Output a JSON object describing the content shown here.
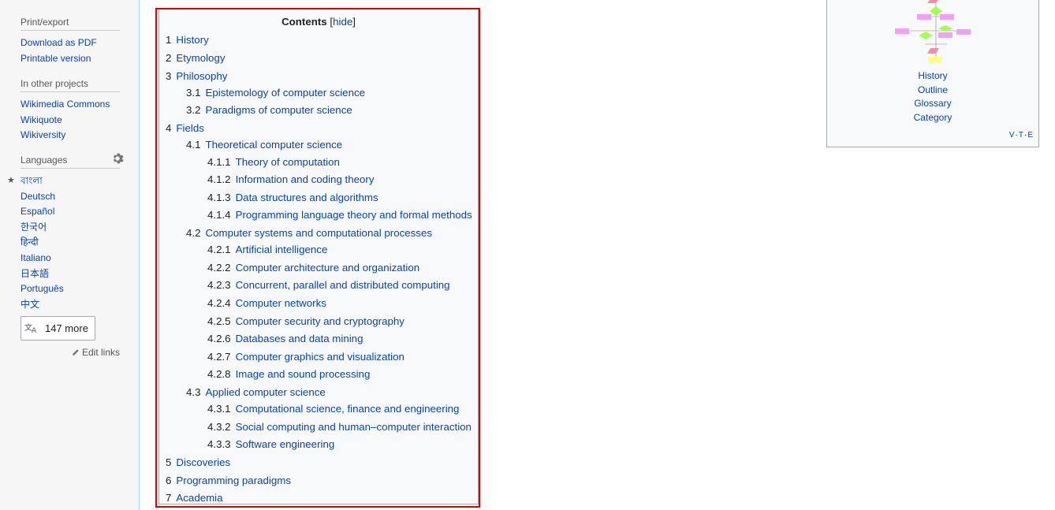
{
  "sidebar": {
    "print_export": {
      "heading": "Print/export",
      "items": [
        "Download as PDF",
        "Printable version"
      ]
    },
    "other_projects": {
      "heading": "In other projects",
      "items": [
        "Wikimedia Commons",
        "Wikiquote",
        "Wikiversity"
      ]
    },
    "languages": {
      "heading": "Languages",
      "items": [
        "বাংলা",
        "Deutsch",
        "Español",
        "한국어",
        "हिन्दी",
        "Italiano",
        "日本語",
        "Português",
        "中文"
      ],
      "more_label": "147 more",
      "edit_links_label": "Edit links"
    }
  },
  "toc": {
    "title": "Contents",
    "hide_label": "hide",
    "items": [
      {
        "num": "1",
        "text": "History"
      },
      {
        "num": "2",
        "text": "Etymology"
      },
      {
        "num": "3",
        "text": "Philosophy"
      },
      {
        "num": "3.1",
        "text": "Epistemology of computer science"
      },
      {
        "num": "3.2",
        "text": "Paradigms of computer science"
      },
      {
        "num": "4",
        "text": "Fields"
      },
      {
        "num": "4.1",
        "text": "Theoretical computer science"
      },
      {
        "num": "4.1.1",
        "text": "Theory of computation"
      },
      {
        "num": "4.1.2",
        "text": "Information and coding theory"
      },
      {
        "num": "4.1.3",
        "text": "Data structures and algorithms"
      },
      {
        "num": "4.1.4",
        "text": "Programming language theory and formal methods"
      },
      {
        "num": "4.2",
        "text": "Computer systems and computational processes"
      },
      {
        "num": "4.2.1",
        "text": "Artificial intelligence"
      },
      {
        "num": "4.2.2",
        "text": "Computer architecture and organization"
      },
      {
        "num": "4.2.3",
        "text": "Concurrent, parallel and distributed computing"
      },
      {
        "num": "4.2.4",
        "text": "Computer networks"
      },
      {
        "num": "4.2.5",
        "text": "Computer security and cryptography"
      },
      {
        "num": "4.2.6",
        "text": "Databases and data mining"
      },
      {
        "num": "4.2.7",
        "text": "Computer graphics and visualization"
      },
      {
        "num": "4.2.8",
        "text": "Image and sound processing"
      },
      {
        "num": "4.3",
        "text": "Applied computer science"
      },
      {
        "num": "4.3.1",
        "text": "Computational science, finance and engineering"
      },
      {
        "num": "4.3.2",
        "text": "Social computing and human–computer interaction"
      },
      {
        "num": "4.3.3",
        "text": "Software engineering"
      },
      {
        "num": "5",
        "text": "Discoveries"
      },
      {
        "num": "6",
        "text": "Programming paradigms"
      },
      {
        "num": "7",
        "text": "Academia"
      }
    ]
  },
  "navbox": {
    "links": [
      "History",
      "Outline",
      "Glossary",
      "Category"
    ],
    "vte": [
      "V",
      "T",
      "E"
    ]
  },
  "colors": {
    "link": "#0645ad",
    "highlight": "#e00000"
  }
}
